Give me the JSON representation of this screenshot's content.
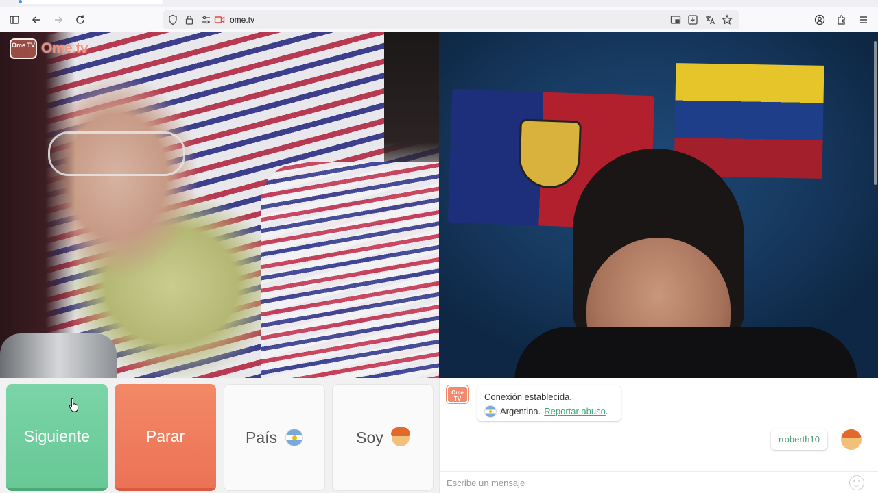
{
  "browser": {
    "url": "ome.tv"
  },
  "logo": {
    "badge_text": "Ome TV",
    "wordmark": "Ome.tv"
  },
  "controls": {
    "next_label": "Siguiente",
    "stop_label": "Parar",
    "country_label": "País",
    "gender_label": "Soy",
    "country_flag": "argentina-flag-icon",
    "gender_icon": "boy-avatar-icon"
  },
  "chat": {
    "system_message": {
      "line1": "Conexión establecida.",
      "country": "Argentina.",
      "report_link": "Reportar abuso",
      "report_suffix": "."
    },
    "user_message": "rroberth10",
    "input_placeholder": "Escribe un mensaje"
  },
  "colors": {
    "next_button": "#6ccb9a",
    "stop_button": "#ef7b5c",
    "link": "#3aa876"
  }
}
